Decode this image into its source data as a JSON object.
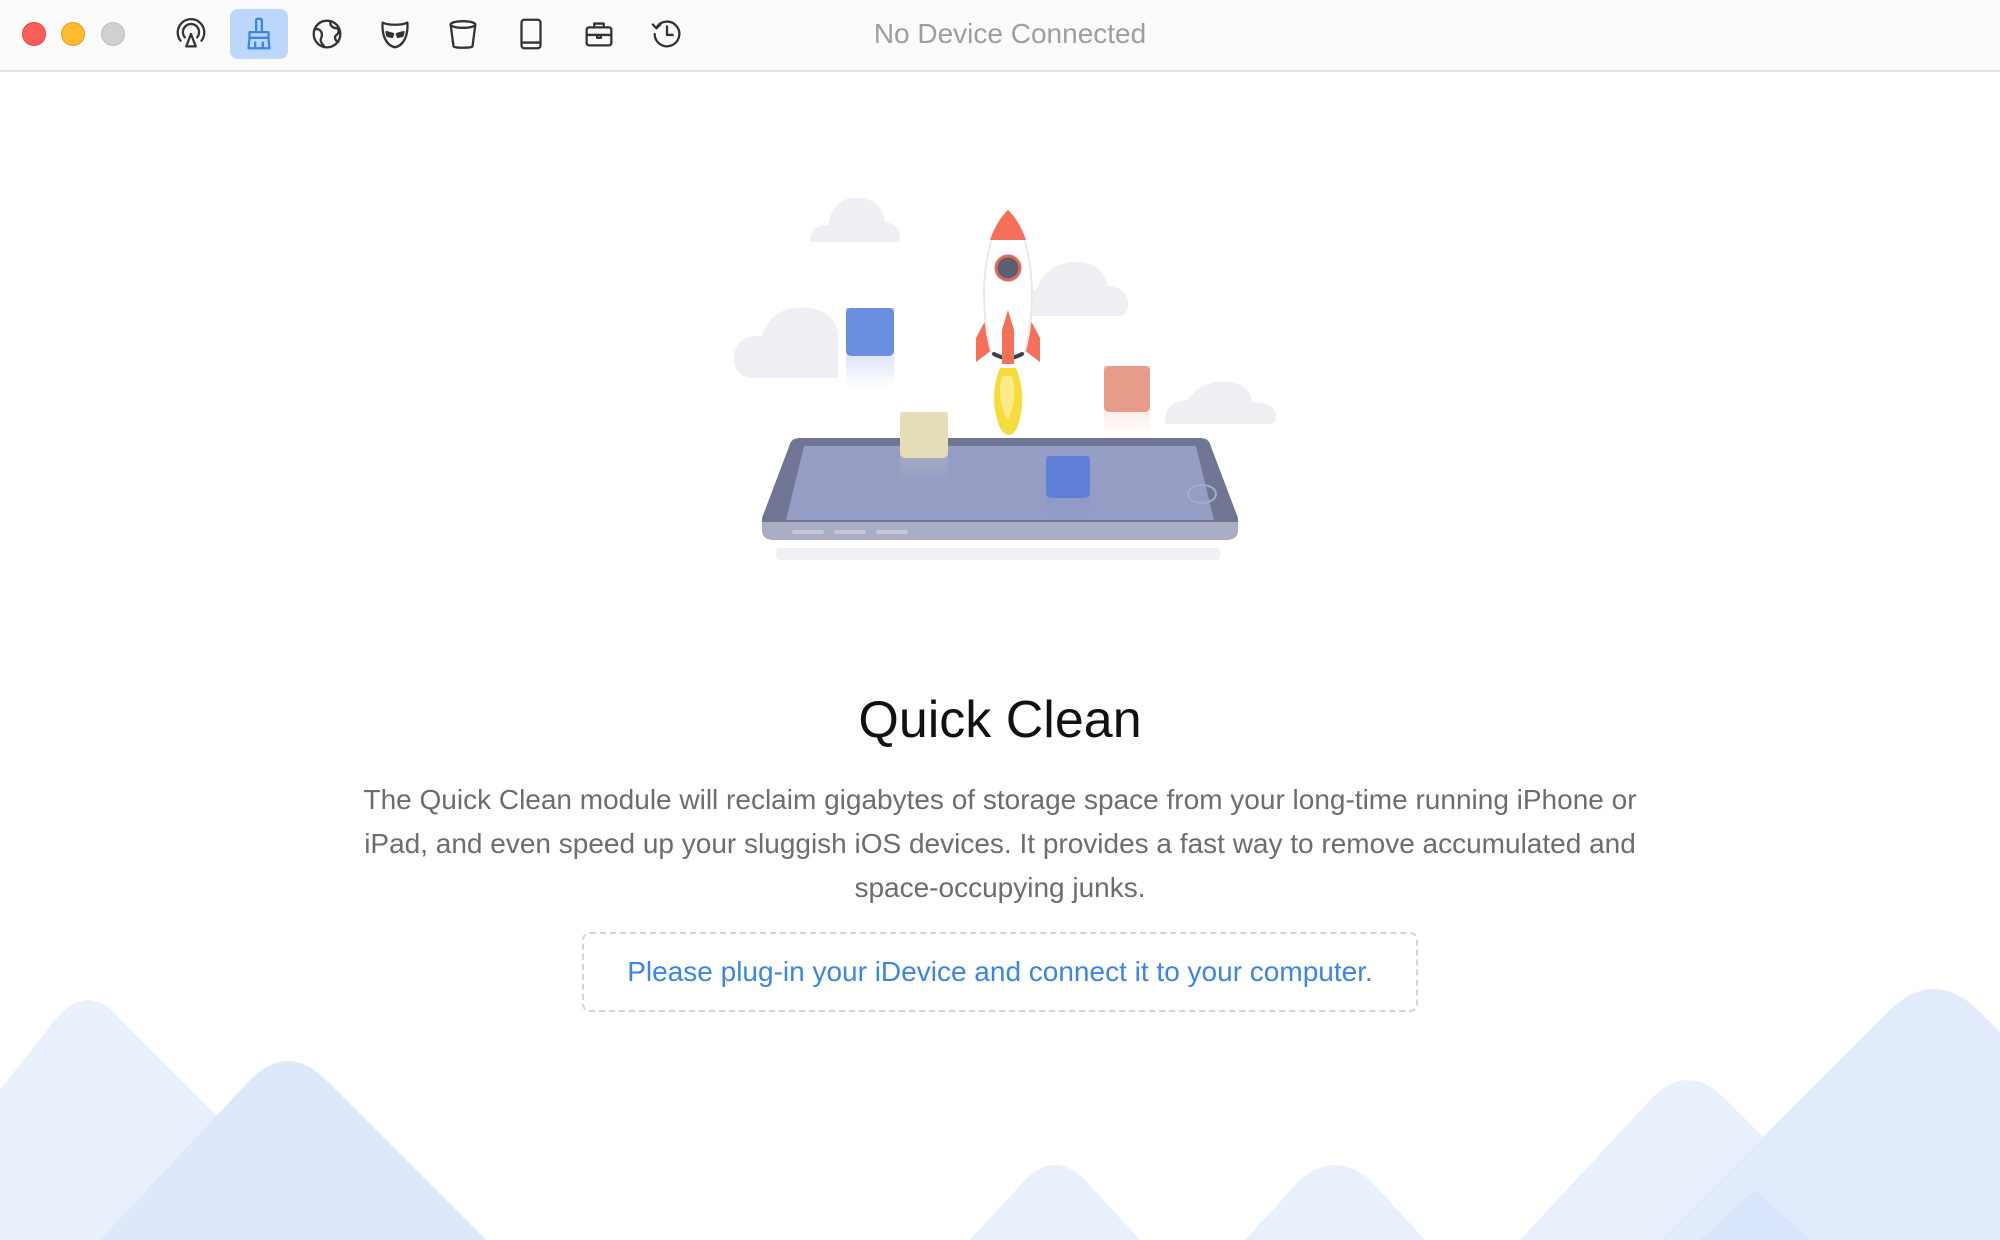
{
  "window": {
    "title": "No Device Connected"
  },
  "toolbar": {
    "items": [
      {
        "icon": "airplay-icon",
        "label": "AirBackup"
      },
      {
        "icon": "broom-icon",
        "label": "Quick Clean",
        "active": true
      },
      {
        "icon": "globe-icon",
        "label": "Internet Clean"
      },
      {
        "icon": "mask-icon",
        "label": "Privacy Clean"
      },
      {
        "icon": "bucket-icon",
        "label": "Junk Clean"
      },
      {
        "icon": "tablet-icon",
        "label": "Device"
      },
      {
        "icon": "briefcase-icon",
        "label": "Toolbox"
      },
      {
        "icon": "history-icon",
        "label": "History"
      }
    ]
  },
  "main": {
    "heading": "Quick Clean",
    "description": "The Quick Clean module will reclaim gigabytes of storage space from your long-time running iPhone or iPad, and even speed up your sluggish iOS devices. It provides a fast way to remove accumulated and space-occupying junks.",
    "connect_prompt": "Please plug-in your iDevice and connect it to your computer."
  },
  "colors": {
    "accent": "#3a86e6",
    "active_tool_bg": "#bcd7fb",
    "close": "#fc5e57",
    "minimize": "#fdbc2e",
    "zoom": "#d0d0d0"
  }
}
